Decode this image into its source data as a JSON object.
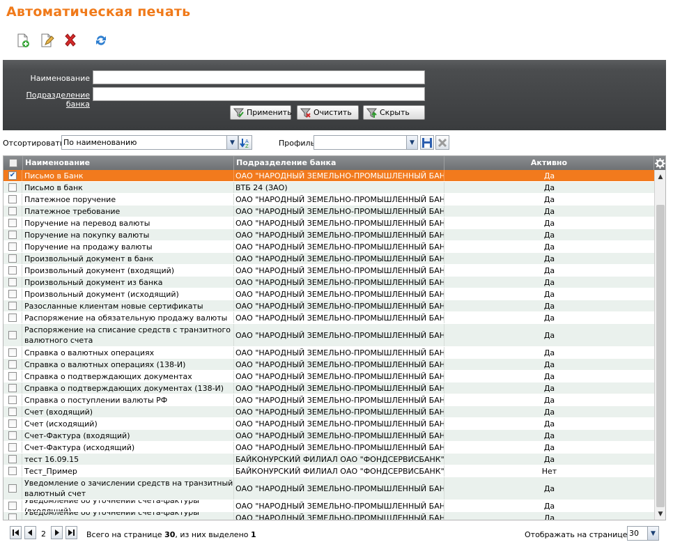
{
  "page": {
    "title": "Автоматическая печать"
  },
  "toolbar": {
    "buttons": [
      {
        "name": "add-icon"
      },
      {
        "name": "edit-icon"
      },
      {
        "name": "delete-icon"
      },
      {
        "name": "refresh-icon"
      }
    ]
  },
  "filter": {
    "name_label": "Наименование",
    "division_label": "Подразделение банка",
    "name_value": "",
    "division_value": "",
    "apply_label": "Применить",
    "clear_label": "Очистить",
    "hide_label": "Скрыть"
  },
  "sort": {
    "label": "Отсортировать",
    "value": "По наименованию",
    "profile_label": "Профиль",
    "profile_value": ""
  },
  "grid": {
    "columns": {
      "name": "Наименование",
      "division": "Подразделение банка",
      "active": "Активно"
    },
    "rows": [
      {
        "name": "Письмо в Банк",
        "division": "ОАО \"НАРОДНЫЙ ЗЕМЕЛЬНО-ПРОМЫШЛЕННЫЙ БАНК\"",
        "active": "Да",
        "checked": true,
        "selected": true
      },
      {
        "name": "Письмо в банк",
        "division": "ВТБ 24 (ЗАО)",
        "active": "Да"
      },
      {
        "name": "Платежное поручение",
        "division": "ОАО \"НАРОДНЫЙ ЗЕМЕЛЬНО-ПРОМЫШЛЕННЫЙ БАНК\"",
        "active": "Да"
      },
      {
        "name": "Платежное требование",
        "division": "ОАО \"НАРОДНЫЙ ЗЕМЕЛЬНО-ПРОМЫШЛЕННЫЙ БАНК\"",
        "active": "Да"
      },
      {
        "name": "Поручение на перевод валюты",
        "division": "ОАО \"НАРОДНЫЙ ЗЕМЕЛЬНО-ПРОМЫШЛЕННЫЙ БАНК\"",
        "active": "Да"
      },
      {
        "name": "Поручение на покупку валюты",
        "division": "ОАО \"НАРОДНЫЙ ЗЕМЕЛЬНО-ПРОМЫШЛЕННЫЙ БАНК\"",
        "active": "Да"
      },
      {
        "name": "Поручение на продажу валюты",
        "division": "ОАО \"НАРОДНЫЙ ЗЕМЕЛЬНО-ПРОМЫШЛЕННЫЙ БАНК\"",
        "active": "Да"
      },
      {
        "name": "Произвольный документ в банк",
        "division": "ОАО \"НАРОДНЫЙ ЗЕМЕЛЬНО-ПРОМЫШЛЕННЫЙ БАНК\"",
        "active": "Да"
      },
      {
        "name": "Произвольный документ (входящий)",
        "division": "ОАО \"НАРОДНЫЙ ЗЕМЕЛЬНО-ПРОМЫШЛЕННЫЙ БАНК\"",
        "active": "Да"
      },
      {
        "name": "Произвольный документ из банка",
        "division": "ОАО \"НАРОДНЫЙ ЗЕМЕЛЬНО-ПРОМЫШЛЕННЫЙ БАНК\"",
        "active": "Да"
      },
      {
        "name": "Произвольный документ (исходящий)",
        "division": "ОАО \"НАРОДНЫЙ ЗЕМЕЛЬНО-ПРОМЫШЛЕННЫЙ БАНК\"",
        "active": "Да"
      },
      {
        "name": "Разосланные клиентам новые сертификаты",
        "division": "ОАО \"НАРОДНЫЙ ЗЕМЕЛЬНО-ПРОМЫШЛЕННЫЙ БАНК\"",
        "active": "Да"
      },
      {
        "name": "Распоряжение на обязательную продажу валюты",
        "division": "ОАО \"НАРОДНЫЙ ЗЕМЕЛЬНО-ПРОМЫШЛЕННЫЙ БАНК\"",
        "active": "Да"
      },
      {
        "name": "Распоряжение на списание средств с транзитного валютного счета",
        "division": "ОАО \"НАРОДНЫЙ ЗЕМЕЛЬНО-ПРОМЫШЛЕННЫЙ БАНК\"",
        "active": "Да",
        "tall": true
      },
      {
        "name": "Справка о валютных операциях",
        "division": "ОАО \"НАРОДНЫЙ ЗЕМЕЛЬНО-ПРОМЫШЛЕННЫЙ БАНК\"",
        "active": "Да"
      },
      {
        "name": "Справка о валютных операциях (138-И)",
        "division": "ОАО \"НАРОДНЫЙ ЗЕМЕЛЬНО-ПРОМЫШЛЕННЫЙ БАНК\"",
        "active": "Да"
      },
      {
        "name": "Справка о подтверждающих документах",
        "division": "ОАО \"НАРОДНЫЙ ЗЕМЕЛЬНО-ПРОМЫШЛЕННЫЙ БАНК\"",
        "active": "Да"
      },
      {
        "name": "Справка о подтверждающих документах (138-И)",
        "division": "ОАО \"НАРОДНЫЙ ЗЕМЕЛЬНО-ПРОМЫШЛЕННЫЙ БАНК\"",
        "active": "Да"
      },
      {
        "name": "Справка о поступлении валюты РФ",
        "division": "ОАО \"НАРОДНЫЙ ЗЕМЕЛЬНО-ПРОМЫШЛЕННЫЙ БАНК\"",
        "active": "Да"
      },
      {
        "name": "Счет (входящий)",
        "division": "ОАО \"НАРОДНЫЙ ЗЕМЕЛЬНО-ПРОМЫШЛЕННЫЙ БАНК\"",
        "active": "Да"
      },
      {
        "name": "Счет (исходящий)",
        "division": "ОАО \"НАРОДНЫЙ ЗЕМЕЛЬНО-ПРОМЫШЛЕННЫЙ БАНК\"",
        "active": "Да"
      },
      {
        "name": "Счет-Фактура (входящий)",
        "division": "ОАО \"НАРОДНЫЙ ЗЕМЕЛЬНО-ПРОМЫШЛЕННЫЙ БАНК\"",
        "active": "Да"
      },
      {
        "name": "Счет-Фактура (исходящий)",
        "division": "ОАО \"НАРОДНЫЙ ЗЕМЕЛЬНО-ПРОМЫШЛЕННЫЙ БАНК\"",
        "active": "Да"
      },
      {
        "name": "тест 16.09.15",
        "division": "БАЙКОНУРСКИЙ ФИЛИАЛ ОАО \"ФОНДСЕРВИСБАНК\"",
        "active": "Да"
      },
      {
        "name": "Тест_Пример",
        "division": "БАЙКОНУРСКИЙ ФИЛИАЛ ОАО \"ФОНДСЕРВИСБАНК\"",
        "active": "Нет"
      },
      {
        "name": "Уведомление о зачислении средств на транзитный валютный счет",
        "division": "ОАО \"НАРОДНЫЙ ЗЕМЕЛЬНО-ПРОМЫШЛЕННЫЙ БАНК\"",
        "active": "Да",
        "tall": true
      },
      {
        "name": "Уведомление об уточнении счета-фактуры (входящий)",
        "division": "ОАО \"НАРОДНЫЙ ЗЕМЕЛЬНО-ПРОМЫШЛЕННЫЙ БАНК\"",
        "active": "Да"
      },
      {
        "name": "Уведомление об уточнении счета-фактуры (исходящий)",
        "division": "ОАО \"НАРОДНЫЙ ЗЕМЕЛЬНО-ПРОМЫШЛЕННЫЙ БАНК\"",
        "active": "Да"
      }
    ]
  },
  "pager": {
    "page": "2",
    "summary_prefix": "Всего на странице ",
    "total": "30",
    "summary_mid": ", из них выделено ",
    "selected": "1",
    "per_page_label": "Отображать на странице по",
    "per_page_value": "30"
  },
  "colors": {
    "accent": "#f07a1a",
    "selected_row": "#f27a1d",
    "alt_row": "#eaf1ed"
  }
}
